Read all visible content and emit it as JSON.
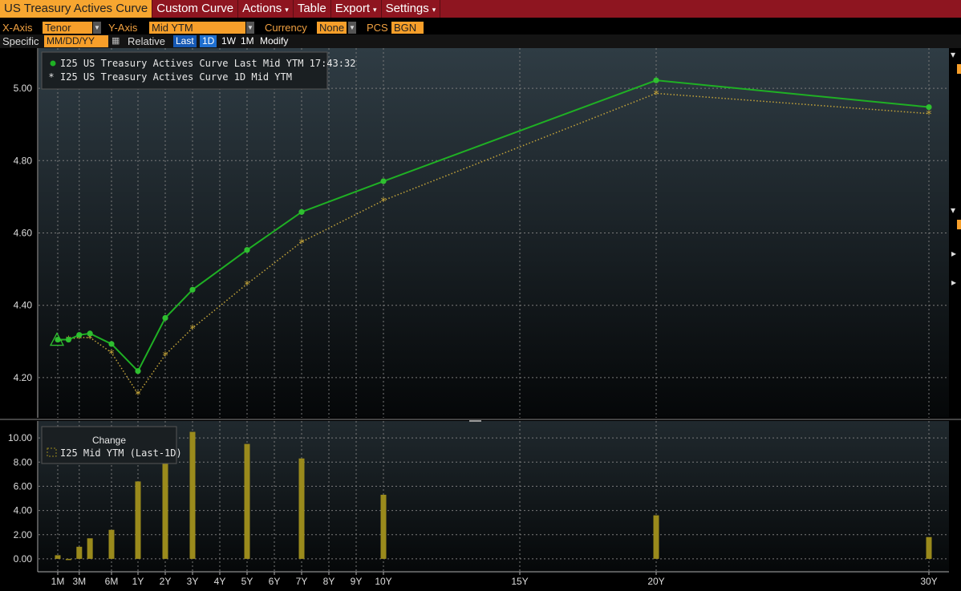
{
  "menu": {
    "title": "US Treasury Actives Curve",
    "custom_curve": "Custom Curve",
    "actions": "Actions",
    "table": "Table",
    "export": "Export",
    "settings": "Settings",
    "caret": "▾"
  },
  "controls": {
    "x_axis_label": "X-Axis",
    "x_axis_value": "Tenor",
    "y_axis_label": "Y-Axis",
    "y_axis_value": "Mid YTM",
    "currency_label": "Currency",
    "currency_value": "None",
    "pcs_label": "PCS",
    "pcs_value": "BGN",
    "specific_label": "Specific",
    "date_placeholder": "MM/DD/YY",
    "relative_label": "Relative",
    "relative_options": [
      "Last",
      "1D",
      "1W",
      "1M"
    ],
    "modify_label": "Modify"
  },
  "legend": {
    "main": [
      "I25 US Treasury Actives Curve Last Mid YTM 17:43:32",
      "I25 US Treasury Actives Curve 1D Mid YTM"
    ],
    "change_title": "Change",
    "change_series": "I25 Mid YTM (Last-1D)"
  },
  "colors": {
    "last": "#1fb024",
    "one_day": "#c4a43a",
    "bar": "#9a8a1c",
    "grid": "#7a7a7a",
    "marker": "#2fbf30"
  },
  "chart_data": [
    {
      "type": "line",
      "x_ticks": [
        {
          "label": "1M",
          "t": 0.0833
        },
        {
          "label": "3M",
          "t": 0.25
        },
        {
          "label": "6M",
          "t": 0.5
        },
        {
          "label": "1Y",
          "t": 1
        },
        {
          "label": "2Y",
          "t": 2
        },
        {
          "label": "3Y",
          "t": 3
        },
        {
          "label": "4Y",
          "t": 4
        },
        {
          "label": "5Y",
          "t": 5
        },
        {
          "label": "6Y",
          "t": 6
        },
        {
          "label": "7Y",
          "t": 7
        },
        {
          "label": "8Y",
          "t": 8
        },
        {
          "label": "9Y",
          "t": 9
        },
        {
          "label": "10Y",
          "t": 10
        },
        {
          "label": "15Y",
          "t": 15
        },
        {
          "label": "20Y",
          "t": 20
        },
        {
          "label": "30Y",
          "t": 30
        }
      ],
      "y_ticks": [
        "4.20",
        "4.40",
        "4.60",
        "4.80",
        "5.00"
      ],
      "ylim": [
        4.1,
        5.1
      ],
      "series": [
        {
          "name": "I25 US Treasury Actives Curve Last Mid YTM 17:43:32",
          "points": [
            {
              "t": 0.0833,
              "y": 4.305
            },
            {
              "t": 0.1667,
              "y": 4.305
            },
            {
              "t": 0.25,
              "y": 4.318
            },
            {
              "t": 0.333,
              "y": 4.322
            },
            {
              "t": 0.5,
              "y": 4.293
            },
            {
              "t": 1,
              "y": 4.218
            },
            {
              "t": 2,
              "y": 4.365
            },
            {
              "t": 3,
              "y": 4.443
            },
            {
              "t": 5,
              "y": 4.553
            },
            {
              "t": 7,
              "y": 4.658
            },
            {
              "t": 10,
              "y": 4.743
            },
            {
              "t": 20,
              "y": 5.022
            },
            {
              "t": 30,
              "y": 4.948
            }
          ]
        },
        {
          "name": "I25 US Treasury Actives Curve 1D Mid YTM",
          "points": [
            {
              "t": 0.0833,
              "y": 4.302
            },
            {
              "t": 0.1667,
              "y": 4.306
            },
            {
              "t": 0.25,
              "y": 4.311
            },
            {
              "t": 0.333,
              "y": 4.311
            },
            {
              "t": 0.5,
              "y": 4.269
            },
            {
              "t": 1,
              "y": 4.155
            },
            {
              "t": 2,
              "y": 4.263
            },
            {
              "t": 3,
              "y": 4.337
            },
            {
              "t": 5,
              "y": 4.459
            },
            {
              "t": 7,
              "y": 4.575
            },
            {
              "t": 10,
              "y": 4.69
            },
            {
              "t": 20,
              "y": 4.986
            },
            {
              "t": 30,
              "y": 4.93
            }
          ]
        }
      ]
    },
    {
      "type": "bar",
      "title": "Change",
      "y_ticks": [
        "0.00",
        "2.00",
        "4.00",
        "6.00",
        "8.00",
        "10.00"
      ],
      "ylim": [
        -1,
        11
      ],
      "series": [
        {
          "name": "I25 Mid YTM (Last-1D)",
          "points": [
            {
              "t": 0.0833,
              "v": 0.3
            },
            {
              "t": 0.1667,
              "v": -0.1
            },
            {
              "t": 0.25,
              "v": 1.0
            },
            {
              "t": 0.333,
              "v": 1.7
            },
            {
              "t": 0.5,
              "v": 2.4
            },
            {
              "t": 1,
              "v": 6.4
            },
            {
              "t": 2,
              "v": 10.2
            },
            {
              "t": 3,
              "v": 10.5
            },
            {
              "t": 5,
              "v": 9.5
            },
            {
              "t": 7,
              "v": 8.3
            },
            {
              "t": 10,
              "v": 5.3
            },
            {
              "t": 20,
              "v": 3.6
            },
            {
              "t": 30,
              "v": 1.8
            }
          ]
        }
      ]
    }
  ]
}
